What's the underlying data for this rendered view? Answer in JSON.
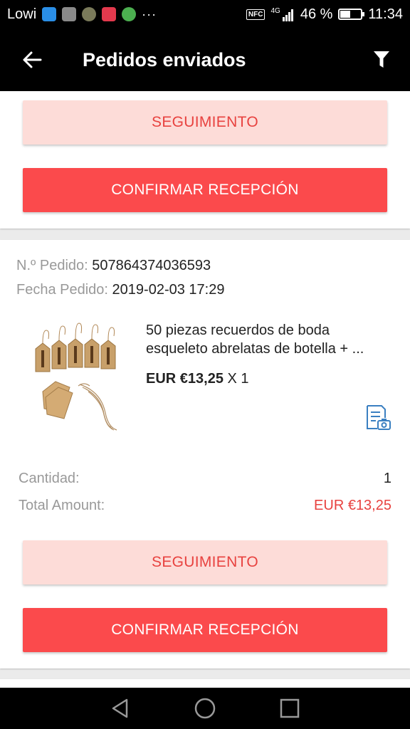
{
  "status_bar": {
    "carrier": "Lowi",
    "more_indicator": "···",
    "nfc": "NFC",
    "network": "4G",
    "battery_percent": "46 %",
    "battery_level": 0.46,
    "time": "11:34",
    "notification_icons": [
      "messenger-icon",
      "photo-icon",
      "avatar-icon",
      "pocket-icon",
      "b-app-icon"
    ]
  },
  "app_bar": {
    "title": "Pedidos enviados",
    "back_icon": "back-arrow-icon",
    "filter_icon": "filter-icon"
  },
  "previous_order": {
    "tracking_label": "SEGUIMIENTO",
    "confirm_label": "CONFIRMAR RECEPCIÓN"
  },
  "order": {
    "number_label": "N.º Pedido:",
    "number": "507864374036593",
    "date_label": "Fecha Pedido:",
    "date": "2019-02-03 17:29",
    "product": {
      "title": "50 piezas recuerdos de boda esqueleto abrelatas de botella + ...",
      "price": "EUR €13,25",
      "quantity_text": "X 1"
    },
    "quantity_label": "Cantidad:",
    "quantity": "1",
    "total_label": "Total Amount:",
    "total": "EUR €13,25",
    "tracking_label": "SEGUIMIENTO",
    "confirm_label": "CONFIRMAR RECEPCIÓN"
  },
  "colors": {
    "accent": "#fb4a4c",
    "tracking_bg": "#fddcd8",
    "accent_text": "#e8423f",
    "link_icon": "#3a7fc1"
  }
}
